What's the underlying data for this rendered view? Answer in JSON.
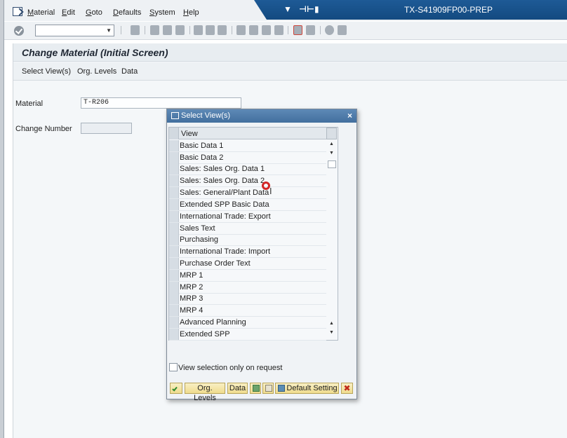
{
  "menu": {
    "items": [
      {
        "label": "Material",
        "underline": "M",
        "rest": "aterial"
      },
      {
        "label": "Edit",
        "underline": "E",
        "rest": "dit"
      },
      {
        "label": "Goto",
        "underline": "G",
        "rest": "oto"
      },
      {
        "label": "Defaults",
        "underline": "D",
        "rest": "efaults"
      },
      {
        "label": "System",
        "underline": "S",
        "rest": "ystem"
      },
      {
        "label": "Help",
        "underline": "H",
        "rest": "elp"
      }
    ]
  },
  "system": {
    "title": "TX-S41909FP00-PREP"
  },
  "screen": {
    "title": "Change Material (Initial Screen)",
    "app_toolbar": [
      "Select View(s)",
      "Org. Levels",
      "Data"
    ],
    "fields": {
      "material_label": "Material",
      "material_value": "T-R206",
      "change_number_label": "Change Number",
      "change_number_value": ""
    }
  },
  "dialog": {
    "title": "Select View(s)",
    "column_header": "View",
    "views": [
      "Basic Data 1",
      "Basic Data 2",
      "Sales: Sales Org. Data 1",
      "Sales: Sales Org. Data 2",
      "Sales: General/Plant Data",
      "Extended SPP Basic Data",
      "International Trade: Export",
      "Sales Text",
      "Purchasing",
      "International Trade: Import",
      "Purchase Order Text",
      "MRP 1",
      "MRP 2",
      "MRP 3",
      "MRP 4",
      "Advanced Planning",
      "Extended SPP"
    ],
    "checkbox_label": "View selection only on request",
    "checkbox_checked": false,
    "buttons": {
      "org_levels": "Org. Levels",
      "data": "Data",
      "default_setting": "Default Setting"
    }
  },
  "colors": {
    "system_band": "#134a80",
    "dialog_title": "#426f9e",
    "button_yellow": "#efdc8e"
  }
}
